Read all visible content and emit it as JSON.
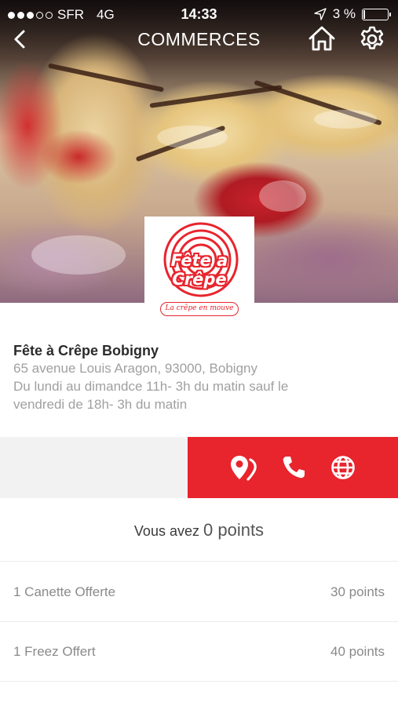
{
  "status_bar": {
    "carrier": "SFR",
    "network": "4G",
    "time": "14:33",
    "battery": "3 %",
    "battery_level": 0.03,
    "signal_bars": 3
  },
  "nav": {
    "title": "COMMERCES",
    "back_icon": "chevron-left-icon",
    "home_icon": "home-icon",
    "settings_icon": "gear-icon"
  },
  "store": {
    "logo_text": "Fête a Crêpe",
    "logo_tagline": "La crêpe en mouve",
    "name": "Fête à Crêpe Bobigny",
    "address": "65 avenue Louis Aragon, 93000, Bobigny",
    "hours_line1": "Du lundi au dimandce 11h- 3h du matin sauf le",
    "hours_line2": "vendredi de 18h- 3h du matin"
  },
  "actions": {
    "map_icon": "map-pin-icon",
    "phone_icon": "phone-icon",
    "web_icon": "globe-icon",
    "accent_color": "#e8242d"
  },
  "points": {
    "prefix": "Vous avez",
    "value": "0 points"
  },
  "rewards": [
    {
      "label": "1 Canette Offerte",
      "points": "30 points"
    },
    {
      "label": "1 Freez Offert",
      "points": "40 points"
    }
  ]
}
